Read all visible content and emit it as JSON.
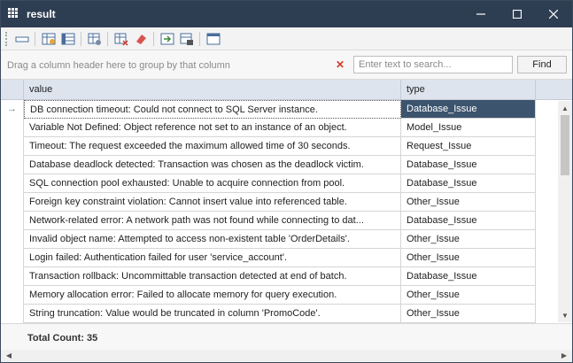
{
  "window": {
    "title": "result",
    "icon": "grid-icon",
    "controls": {
      "minimize": "minimize-icon",
      "maximize": "maximize-icon",
      "close": "close-icon"
    }
  },
  "toolbar": {
    "icons": [
      "single-row-icon",
      "export-excel-icon",
      "columns-icon",
      "table-settings-icon",
      "delete-rows-icon",
      "eraser-icon",
      "export-icon",
      "print-icon",
      "window-icon"
    ]
  },
  "groupbar": {
    "hint": "Drag a column header here to group by that column",
    "clear_icon": "clear-icon"
  },
  "search": {
    "placeholder": "Enter text to search...",
    "value": "",
    "find_label": "Find"
  },
  "columns": [
    "value",
    "type"
  ],
  "rows": [
    {
      "value": "DB connection timeout: Could not connect to SQL Server instance.",
      "type": "Database_Issue",
      "selected": true
    },
    {
      "value": "Variable Not Defined: Object reference not set to an instance of an object.",
      "type": "Model_Issue"
    },
    {
      "value": "Timeout: The request exceeded the maximum allowed time of 30 seconds.",
      "type": "Request_Issue"
    },
    {
      "value": "Database deadlock detected: Transaction was chosen as the deadlock victim.",
      "type": "Database_Issue"
    },
    {
      "value": "SQL connection pool exhausted: Unable to acquire connection from pool.",
      "type": "Database_Issue"
    },
    {
      "value": "Foreign key constraint violation: Cannot insert value into referenced table.",
      "type": "Other_Issue"
    },
    {
      "value": "Network-related error: A network path was not found while connecting to dat...",
      "type": "Database_Issue"
    },
    {
      "value": "Invalid object name: Attempted to access non-existent table 'OrderDetails'.",
      "type": "Other_Issue"
    },
    {
      "value": "Login failed: Authentication failed for user 'service_account'.",
      "type": "Other_Issue"
    },
    {
      "value": "Transaction rollback: Uncommittable transaction detected at end of batch.",
      "type": "Database_Issue"
    },
    {
      "value": "Memory allocation error: Failed to allocate memory for query execution.",
      "type": "Other_Issue"
    },
    {
      "value": "String truncation: Value would be truncated in column 'PromoCode'.",
      "type": "Other_Issue"
    }
  ],
  "footer": {
    "total": "Total Count: 35"
  },
  "colors": {
    "titlebar": "#2e3e52",
    "header_bg": "#dde4ee",
    "selected_bg": "#3c546e",
    "clear_x": "#d23b2b"
  }
}
